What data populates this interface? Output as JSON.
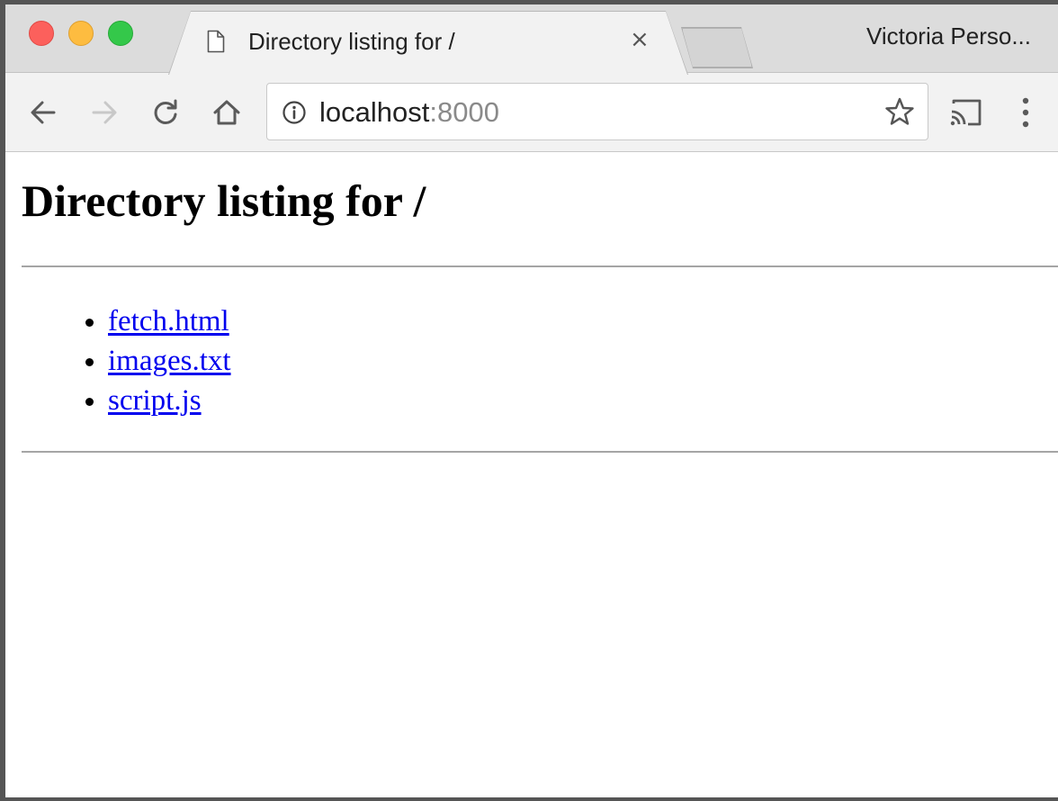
{
  "tab": {
    "title": "Directory listing for /",
    "close_glyph": "×"
  },
  "profile": {
    "name": "Victoria Perso..."
  },
  "address_bar": {
    "host": "localhost",
    "port": ":8000"
  },
  "page": {
    "heading": "Directory listing for /",
    "files": [
      {
        "label": "fetch.html"
      },
      {
        "label": "images.txt"
      },
      {
        "label": "script.js"
      }
    ]
  },
  "icons": {
    "page_favicon": "document-icon",
    "back": "arrow-left-icon",
    "forward": "arrow-right-icon",
    "reload": "reload-icon",
    "home": "home-icon",
    "site_info": "info-icon",
    "bookmark": "star-icon",
    "cast": "cast-icon",
    "menu": "kebab-menu-icon"
  },
  "colors": {
    "tab_active_bg": "#f2f2f2",
    "tabstrip_bg": "#dcdcdc",
    "link": "#0000ee",
    "traffic_close": "#fc605c",
    "traffic_minimize": "#fdbc40",
    "traffic_maximize": "#34c84a"
  }
}
